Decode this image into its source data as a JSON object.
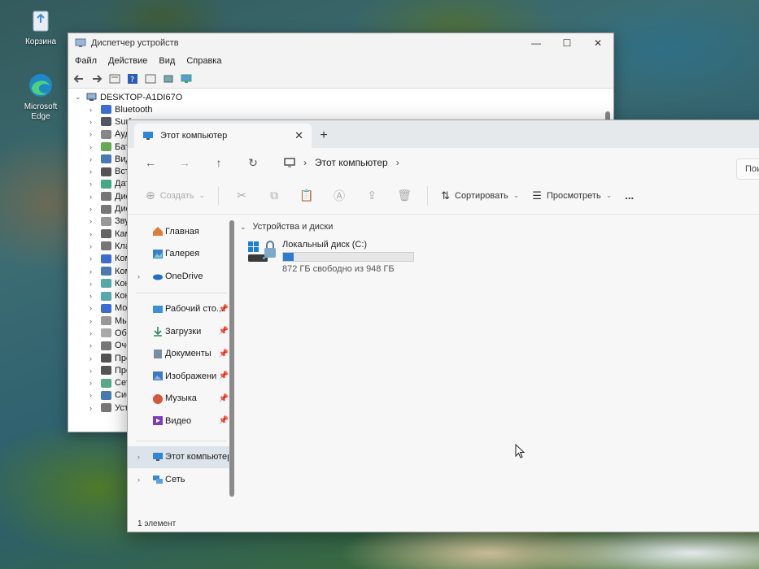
{
  "desktop": {
    "icons": [
      {
        "label": "Корзина",
        "icon": "recycle-bin-icon"
      },
      {
        "label": "Microsoft Edge",
        "icon": "edge-icon"
      }
    ]
  },
  "device_manager": {
    "title": "Диспетчер устройств",
    "menu": [
      "Файл",
      "Действие",
      "Вид",
      "Справка"
    ],
    "root": "DESKTOP-A1DI67O",
    "items": [
      "Bluetooth",
      "Surf",
      "Ауд",
      "Бат",
      "Вид",
      "Вст",
      "Дат",
      "Дис",
      "Дис",
      "Зву",
      "Кам",
      "Кла",
      "Ком",
      "Ком",
      "Кон",
      "Кон",
      "Мо",
      "Мы",
      "Обі",
      "Очс",
      "Про",
      "Про",
      "Сет",
      "Сис",
      "Уст"
    ]
  },
  "explorer": {
    "tab_title": "Этот компьютер",
    "address": "Этот компьютер",
    "search_placeholder": "Поиск в",
    "commands": {
      "create": "Создать",
      "sort": "Сортировать",
      "view": "Просмотреть",
      "more": "..."
    },
    "sidebar": [
      {
        "label": "Главная",
        "pinned": false
      },
      {
        "label": "Галерея",
        "pinned": false
      },
      {
        "label": "OneDrive",
        "pinned": false
      },
      {
        "label": "Рабочий сто...",
        "pinned": true
      },
      {
        "label": "Загрузки",
        "pinned": true
      },
      {
        "label": "Документы",
        "pinned": true
      },
      {
        "label": "Изображени",
        "pinned": true
      },
      {
        "label": "Музыка",
        "pinned": true
      },
      {
        "label": "Видео",
        "pinned": true
      },
      {
        "label": "Этот компьютер",
        "pinned": false
      },
      {
        "label": "Сеть",
        "pinned": false
      }
    ],
    "group_label": "Устройства и диски",
    "drive": {
      "name": "Локальный диск (C:)",
      "free_text": "872 ГБ свободно из 948 ГБ",
      "used_fraction": 0.08
    },
    "status": "1 элемент"
  },
  "colors": {
    "accent": "#2e7ccf",
    "selected_bg": "#dde3ea"
  }
}
